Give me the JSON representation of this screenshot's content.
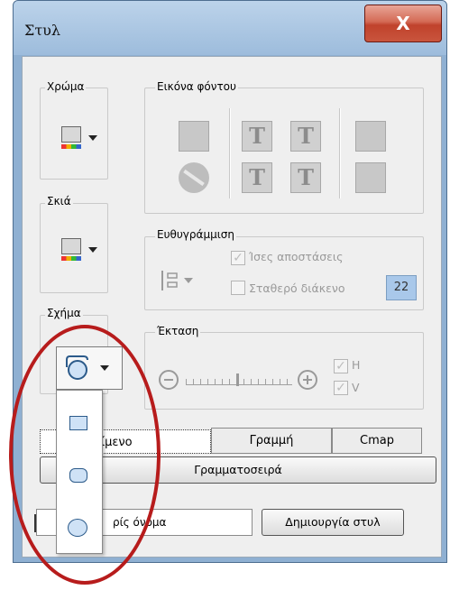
{
  "window": {
    "title": "Στυλ",
    "close_label": "X"
  },
  "groups": {
    "color": "Χρώμα",
    "shadow": "Σκιά",
    "shape": "Σχήμα",
    "background_image": "Εικόνα φόντου",
    "alignment": "Ευθυγράμμιση",
    "extent": "Έκταση"
  },
  "alignment": {
    "equal_spacing_label": "Ίσες αποστάσεις",
    "fixed_spacing_label": "Σταθερό διάκενο",
    "fixed_spacing_value": "22"
  },
  "extent": {
    "h_label": "H",
    "v_label": "V"
  },
  "tabs": [
    {
      "label": "κείμενο"
    },
    {
      "label": "Γραμμή"
    },
    {
      "label": "Cmap"
    }
  ],
  "font_button_label": "Γραμματοσειρά",
  "name_field_value": "ρίς όνομα",
  "create_style_button_label": "Δημιουργία στυλ",
  "shape_menu": {
    "items": [
      {
        "shape": "rectangle"
      },
      {
        "shape": "rounded-rectangle"
      },
      {
        "shape": "ellipse"
      }
    ]
  },
  "colors": {
    "highlight_circle": "#b71c1c",
    "accent": "#2b5a8a"
  }
}
